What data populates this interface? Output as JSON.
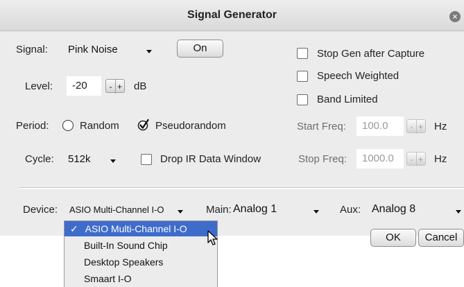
{
  "window": {
    "title": "Signal Generator",
    "close_glyph": "×"
  },
  "signal": {
    "label": "Signal:",
    "value": "Pink Noise",
    "on_button": "On"
  },
  "level": {
    "label": "Level:",
    "value": "-20",
    "unit": "dB",
    "minus": "-",
    "plus": "+"
  },
  "period": {
    "label": "Period:",
    "random": "Random",
    "pseudorandom": "Pseudorandom",
    "selected": "Pseudorandom"
  },
  "cycle": {
    "label": "Cycle:",
    "value": "512k"
  },
  "drop_ir": {
    "label": "Drop IR Data Window",
    "checked": false
  },
  "options": {
    "stop_gen": {
      "label": "Stop Gen after Capture",
      "checked": false
    },
    "speech_weighted": {
      "label": "Speech Weighted",
      "checked": false
    },
    "band_limited": {
      "label": "Band Limited",
      "checked": false
    }
  },
  "start_freq": {
    "label": "Start Freq:",
    "value": "100.0",
    "unit": "Hz",
    "minus": "-",
    "plus": "+"
  },
  "stop_freq": {
    "label": "Stop Freq:",
    "value": "1000.0",
    "unit": "Hz",
    "minus": "-",
    "plus": "+"
  },
  "device": {
    "label": "Device:",
    "value": "ASIO Multi-Channel I-O"
  },
  "main": {
    "label": "Main:",
    "value": "Analog 1"
  },
  "aux": {
    "label": "Aux:",
    "value": "Analog 8"
  },
  "buttons": {
    "ok": "OK",
    "cancel": "Cancel"
  },
  "device_menu": {
    "check_glyph": "✓",
    "items": [
      "ASIO Multi-Channel I-O",
      "Built-In Sound Chip",
      "Desktop Speakers",
      "Smaart I-O"
    ],
    "selected_index": 0
  },
  "colors": {
    "dialog_bg": "#ececec",
    "menu_highlight": "#3e6ccb"
  }
}
